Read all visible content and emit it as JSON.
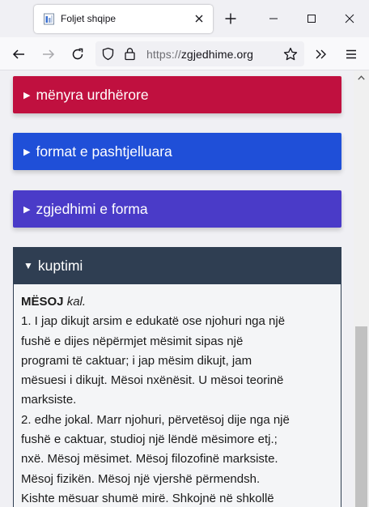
{
  "browser": {
    "tab_title": "Foljet shqipe",
    "url_scheme": "https://",
    "url_host": "zgjedhime.org"
  },
  "sections": [
    {
      "label": "mënyra urdhërore",
      "color": "#c0103f"
    },
    {
      "label": "format e pashtjelluara",
      "color": "#1f4fd8"
    },
    {
      "label": "zgjedhimi e forma",
      "color": "#4a3bc8"
    }
  ],
  "panel": {
    "title": "kuptimi",
    "header_color": "#2f3e52",
    "headword": "MËSOJ",
    "pos": "kal.",
    "lines": [
      "1. I jap dikujt arsim e edukatë ose njohuri nga një",
      "fushë e dijes nëpërmjet mësimit sipas një",
      "programi të caktuar; i jap mësim dikujt, jam",
      "mësuesi i dikujt. Mësoi nxënësit. U mësoi teorinë",
      "marksiste.",
      "2. edhe jokal. Marr njohuri, përvetësoj dije nga një",
      "fushë e caktuar, studioj një lëndë mësimore etj.;",
      "nxë. Mësoj mësimet. Mësoj filozofinë marksiste.",
      "Mësoj fizikën. Mësoj një vjershë përmendsh.",
      "Kishte mësuar shumë mirë. Shkojnë në shkollë"
    ]
  }
}
